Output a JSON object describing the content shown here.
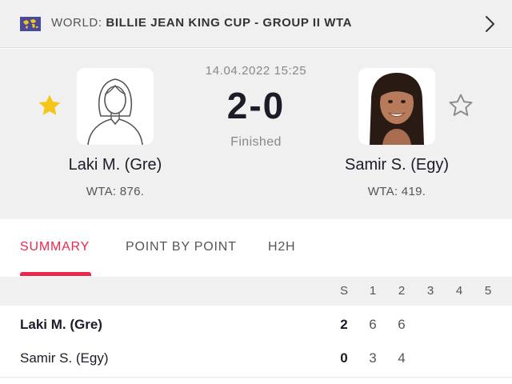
{
  "header": {
    "region_prefix": "WORLD:",
    "competition": "BILLIE JEAN KING CUP - GROUP II WTA"
  },
  "match": {
    "datetime": "14.04.2022 15:25",
    "score": "2-0",
    "status": "Finished",
    "home": {
      "name": "Laki M. (Gre)",
      "rank": "WTA: 876.",
      "favorite": true
    },
    "away": {
      "name": "Samir S. (Egy)",
      "rank": "WTA: 419.",
      "favorite": false
    }
  },
  "tabs": [
    {
      "label": "SUMMARY",
      "active": true
    },
    {
      "label": "POINT BY POINT",
      "active": false
    },
    {
      "label": "H2H",
      "active": false
    }
  ],
  "table": {
    "columns": [
      "S",
      "1",
      "2",
      "3",
      "4",
      "5"
    ],
    "rows": [
      {
        "name": "Laki M. (Gre)",
        "sets": "2",
        "games": [
          "6",
          "6"
        ]
      },
      {
        "name": "Samir S. (Egy)",
        "sets": "0",
        "games": [
          "3",
          "4"
        ]
      }
    ]
  },
  "colors": {
    "accent": "#e8294d",
    "star_active": "#f5c518",
    "header_bg": "#f0f0f0",
    "flag_bg": "#4a4a9c"
  },
  "icons": {
    "flag": "world-flag-icon",
    "chevron": "chevron-right-icon",
    "favorite_on": "star-filled-icon",
    "favorite_off": "star-outline-icon",
    "avatar_placeholder": "female-silhouette-icon"
  }
}
